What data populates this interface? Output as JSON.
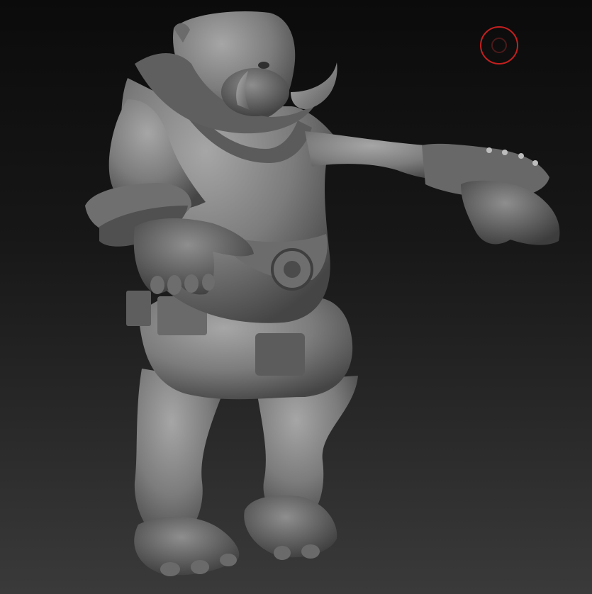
{
  "scene": {
    "background_top": "#0b0b0b",
    "background_bottom": "#3a3a3a",
    "clay_color": "#7c7c7c",
    "clay_dark": "#3d3d3d",
    "clay_light": "#a6a6a6"
  },
  "brush_cursor": {
    "icon": "brush-circle-icon",
    "color": "#c41f1f"
  }
}
